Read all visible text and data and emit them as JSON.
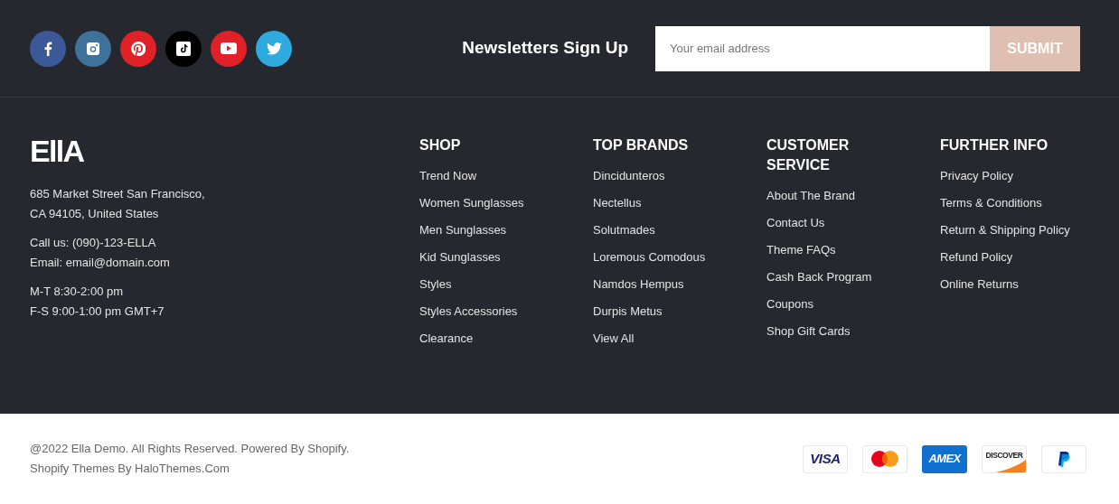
{
  "social": [
    {
      "kind": "facebook",
      "color": "#3b5998"
    },
    {
      "kind": "instagram",
      "color": "#3f729b"
    },
    {
      "kind": "pinterest",
      "color": "#e02127"
    },
    {
      "kind": "tiktok",
      "color": "#000000"
    },
    {
      "kind": "youtube",
      "color": "#e02127"
    },
    {
      "kind": "twitter",
      "color": "#2eaae1"
    }
  ],
  "newsletter": {
    "title": "Newsletters Sign Up",
    "placeholder": "Your email address",
    "button": "SUBMIT"
  },
  "brand": {
    "logo": "EllA",
    "address": [
      "685 Market Street San Francisco,",
      "CA 94105, United States"
    ],
    "contact": [
      "Call us: (090)-123-ELLA",
      "Email: email@domain.com"
    ],
    "hours": [
      "M-T 8:30-2:00 pm",
      "F-S 9:00-1:00 pm GMT+7"
    ]
  },
  "columns": [
    {
      "title": "SHOP",
      "links": [
        "Trend Now",
        "Women Sunglasses",
        "Men Sunglasses",
        "Kid Sunglasses",
        "Styles",
        "Styles Accessories",
        "Clearance"
      ]
    },
    {
      "title": "TOP BRANDS",
      "links": [
        "Dincidunteros",
        "Nectellus",
        "Solutmades",
        "Loremous Comodous",
        "Namdos Hempus",
        "Durpis Metus",
        "View All"
      ]
    },
    {
      "title": "CUSTOMER SERVICE",
      "links": [
        "About The Brand",
        "Contact Us",
        "Theme FAQs",
        "Cash Back Program",
        "Coupons",
        "Shop Gift Cards"
      ]
    },
    {
      "title": "FURTHER INFO",
      "links": [
        "Privacy Policy",
        "Terms & Conditions",
        "Return & Shipping Policy",
        "Refund Policy",
        "Online Returns"
      ]
    }
  ],
  "bottom": {
    "copyright": "@2022 Ella Demo. All Rights Reserved. Powered By Shopify.",
    "credit": "Shopify Themes By HaloThemes.Com"
  },
  "payments": [
    {
      "kind": "visa",
      "label": "VISA"
    },
    {
      "kind": "mastercard"
    },
    {
      "kind": "amex",
      "label": "AMEX"
    },
    {
      "kind": "discover",
      "label": "DISCOVER"
    },
    {
      "kind": "paypal"
    }
  ]
}
